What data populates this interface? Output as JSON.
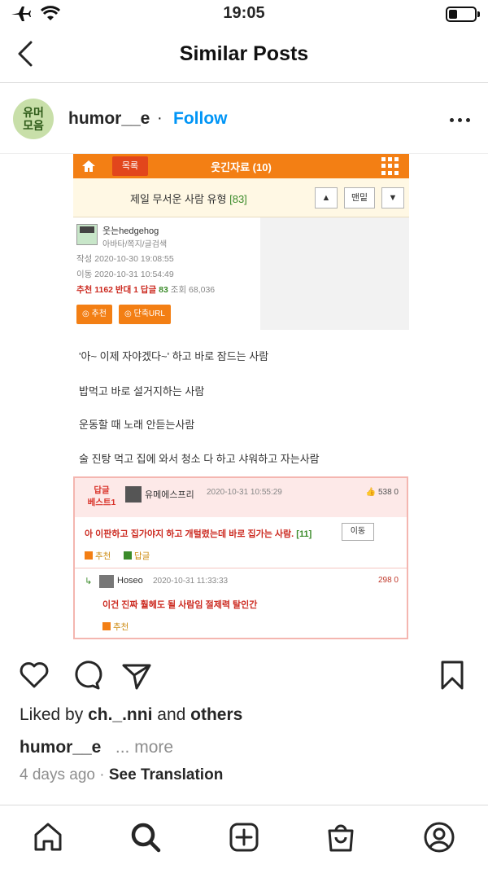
{
  "status_bar": {
    "time": "19:05"
  },
  "header": {
    "title": "Similar Posts"
  },
  "post": {
    "avatar_text": [
      "유머",
      "모음"
    ],
    "username": "humor__e",
    "separator": "·",
    "follow_label": "Follow",
    "liked_prefix": "Liked by",
    "liked_user": "ch._.nni",
    "liked_and": "and",
    "liked_others": "others",
    "caption_user": "humor__e",
    "caption_more": "... more",
    "time_ago": "4 days ago",
    "time_sep": "·",
    "see_translation": "See Translation"
  },
  "embedded": {
    "list_button": "목록",
    "board_title": "웃긴자료 (10)",
    "post_title": "제일 무서운 사람 유형",
    "post_title_count": "[83]",
    "up_button": "▲",
    "bottom_button": "맨밑",
    "down_button": "▼",
    "author": "웃는hedgehog",
    "author_sub": "아바타/쪽지/글검색",
    "created": "작성 2020-10-30 19:08:55",
    "moved": "이동 2020-10-31 10:54:49",
    "stats_prefix": "추천 1162 반대 1 답글",
    "stats_reply": "83",
    "stats_views": "조회 68,036",
    "recommend_button": "추천",
    "short_url_button": "단축URL",
    "body_lines": [
      "'아~ 이제 자야겠다~' 하고 바로 잠드는 사람",
      "밥먹고 바로 설거지하는 사람",
      "운동할 때 노래 안듣는사람",
      "술 진탕 먹고 집에 와서 청소 다 하고 샤워하고 자는사람"
    ],
    "comment": {
      "badge_line1": "답글",
      "badge_line2": "베스트1",
      "name": "유메에스프리",
      "date": "2020-10-31 10:55:29",
      "votes": "538 0",
      "text": "아 이판하고 집가야지 하고 개털렸는데 바로 집가는 사람.",
      "text_count": "[11]",
      "move_button": "이동",
      "recommend": "추천",
      "reply": "답글"
    },
    "reply": {
      "name": "Hoseo",
      "date": "2020-10-31 11:33:33",
      "votes": "298 0",
      "text": "이건 진짜 훨헤도 될 사람임 절제력 탈인간",
      "recommend": "추천"
    }
  },
  "colors": {
    "accent": "#0095f6",
    "board_orange": "#f37f14"
  }
}
